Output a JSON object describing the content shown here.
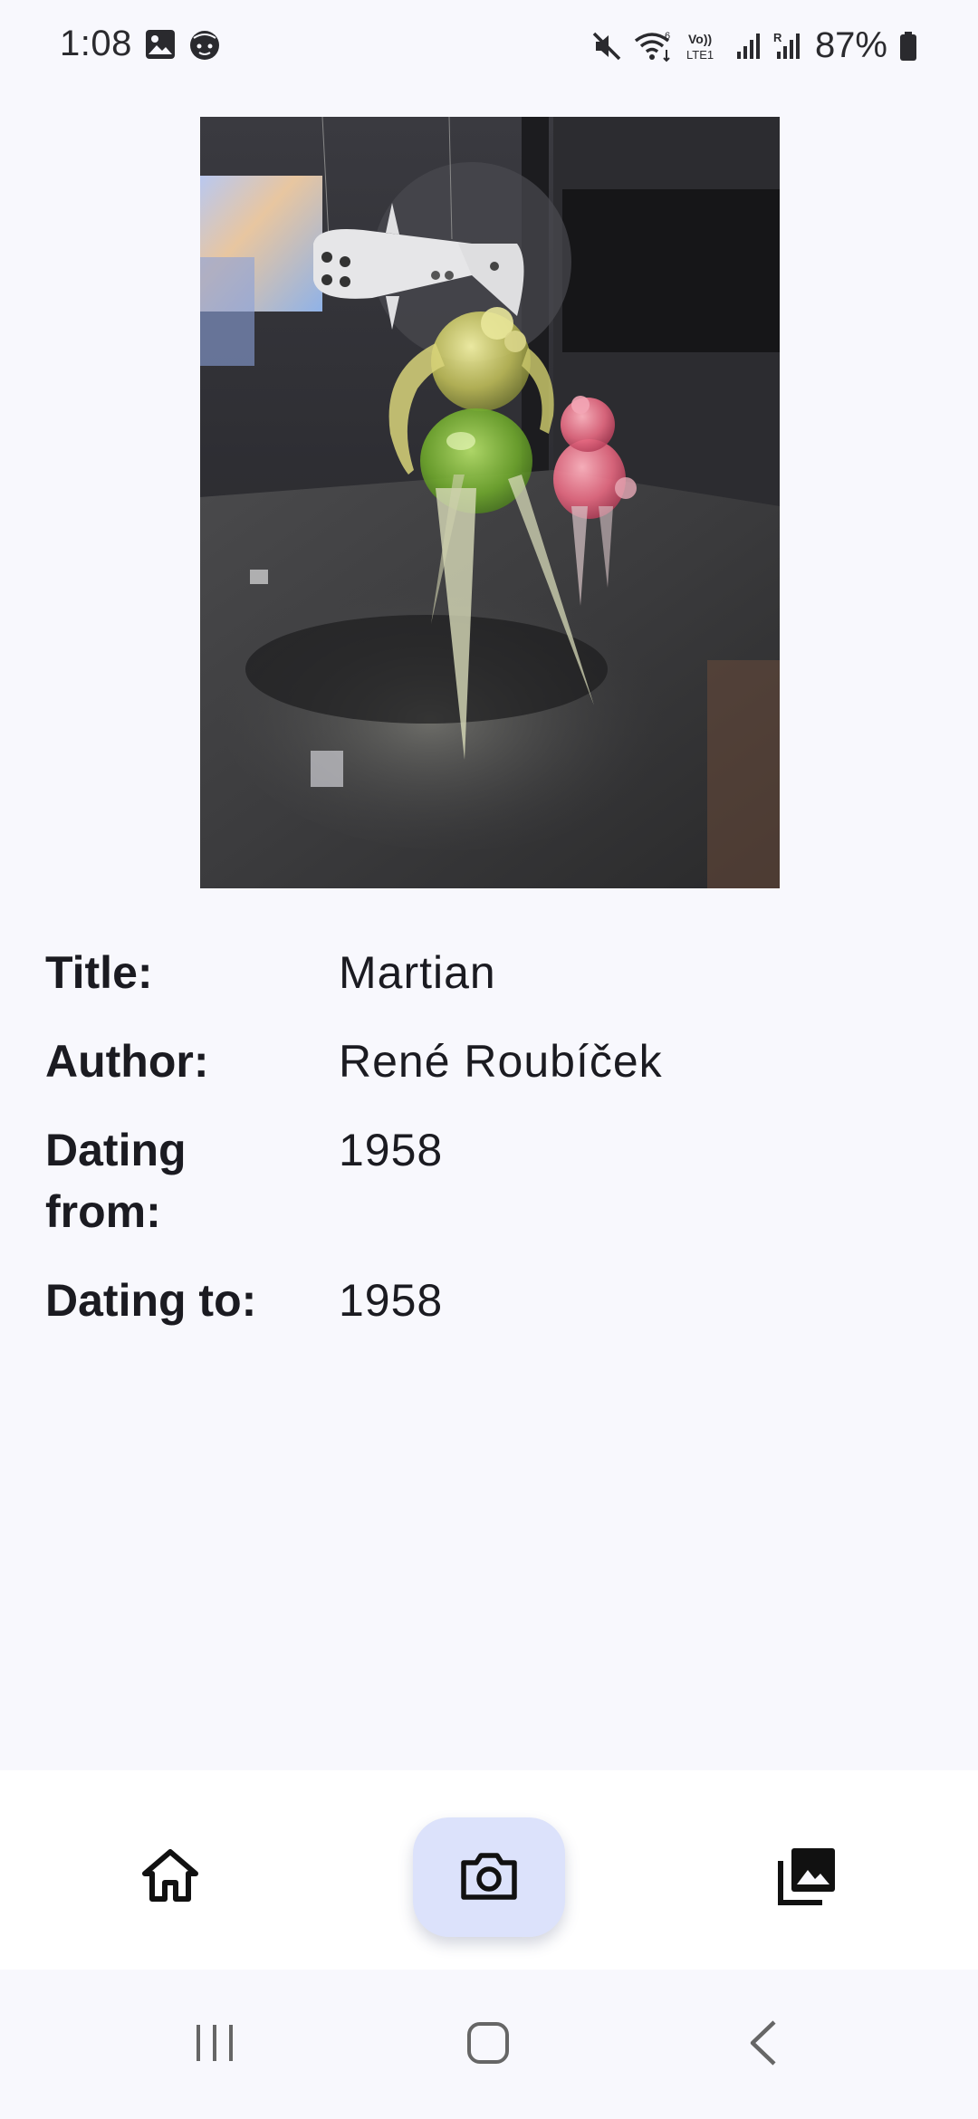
{
  "status_bar": {
    "time": "1:08",
    "battery_percent": "87%",
    "icons": [
      "image-notification-icon",
      "face-notification-icon",
      "mute-icon",
      "wifi-icon",
      "volte-icon",
      "signal-icon",
      "signal-roaming-icon",
      "battery-icon"
    ]
  },
  "artwork": {
    "image_description_icon": "artwork-photo"
  },
  "details": {
    "title_label": "Title:",
    "title_value": "Martian",
    "author_label": "Author:",
    "author_value": "René Roubíček",
    "dating_from_label": "Dating from:",
    "dating_from_value": "1958",
    "dating_to_label": "Dating to:",
    "dating_to_value": "1958"
  },
  "bottom_nav": {
    "items": [
      {
        "icon": "home-icon"
      },
      {
        "icon": "camera-icon",
        "selected": true
      },
      {
        "icon": "gallery-icon"
      }
    ],
    "selected_color": "#dce2fb"
  },
  "system_nav": {
    "buttons": [
      "recents-icon",
      "home-button-icon",
      "back-icon"
    ]
  }
}
